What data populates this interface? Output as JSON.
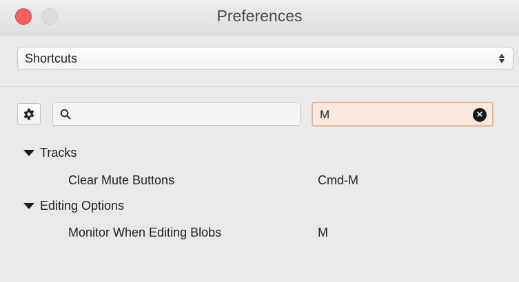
{
  "window": {
    "title": "Preferences"
  },
  "section_select": {
    "value": "Shortcuts"
  },
  "filter": {
    "search_value": "",
    "key_value": "M"
  },
  "icons": {
    "settings": "gear-icon",
    "search": "search-icon",
    "clear": "clear-icon",
    "expand": "disclosure-triangle-icon"
  },
  "colors": {
    "close_button": "#fc5d56",
    "key_field_bg": "#f7e8df",
    "key_field_border": "#e6b894"
  },
  "groups": [
    {
      "label": "Tracks",
      "items": [
        {
          "command": "Clear Mute Buttons",
          "shortcut": "Cmd-M"
        }
      ]
    },
    {
      "label": "Editing Options",
      "items": [
        {
          "command": "Monitor When Editing Blobs",
          "shortcut": "M"
        }
      ]
    }
  ]
}
